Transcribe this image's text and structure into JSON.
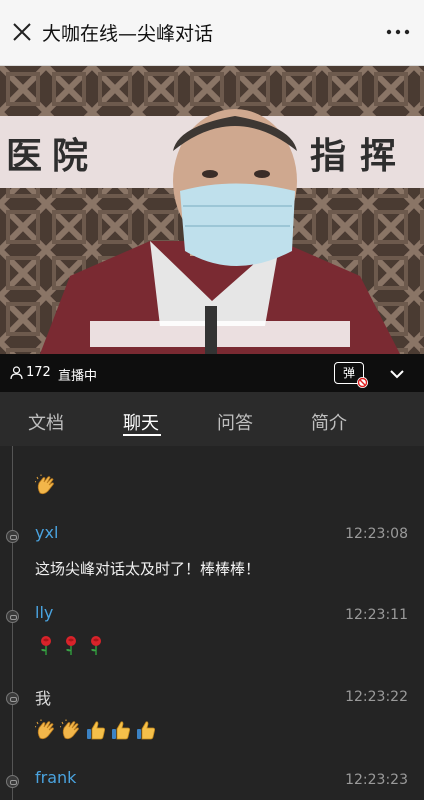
{
  "header": {
    "title": "大咖在线—尖峰对话",
    "close_icon": "close-icon",
    "more_icon": "more-dots-icon"
  },
  "video": {
    "banner_text": "医院 指挥"
  },
  "status": {
    "viewer_count": "172",
    "live_label": "直播中",
    "danmu_label": "弹"
  },
  "tabs": [
    {
      "label": "文档"
    },
    {
      "label": "聊天"
    },
    {
      "label": "问答"
    },
    {
      "label": "简介"
    }
  ],
  "active_tab": "聊天",
  "chat": {
    "messages": [
      {
        "name": "",
        "time": "",
        "text": "",
        "emojis": [
          "clap"
        ]
      },
      {
        "name": "yxl",
        "time": "12:23:08",
        "text": "这场尖峰对话太及时了！棒棒棒！",
        "emojis": []
      },
      {
        "name": "lly",
        "time": "12:23:11",
        "text": "",
        "emojis": [
          "rose",
          "rose",
          "rose"
        ]
      },
      {
        "name": "我",
        "time": "12:23:22",
        "text": "",
        "emojis": [
          "clap",
          "clap",
          "thumbs",
          "thumbs",
          "thumbs"
        ]
      },
      {
        "name": "frank",
        "time": "12:23:23",
        "text": "",
        "emojis": []
      }
    ]
  },
  "colors": {
    "topbar": "#f6f6f6",
    "status_bar": "#0e0e0e",
    "tabs_bg": "#2b2b2b",
    "chat_bg": "#242424",
    "username": "#4aa3df"
  }
}
